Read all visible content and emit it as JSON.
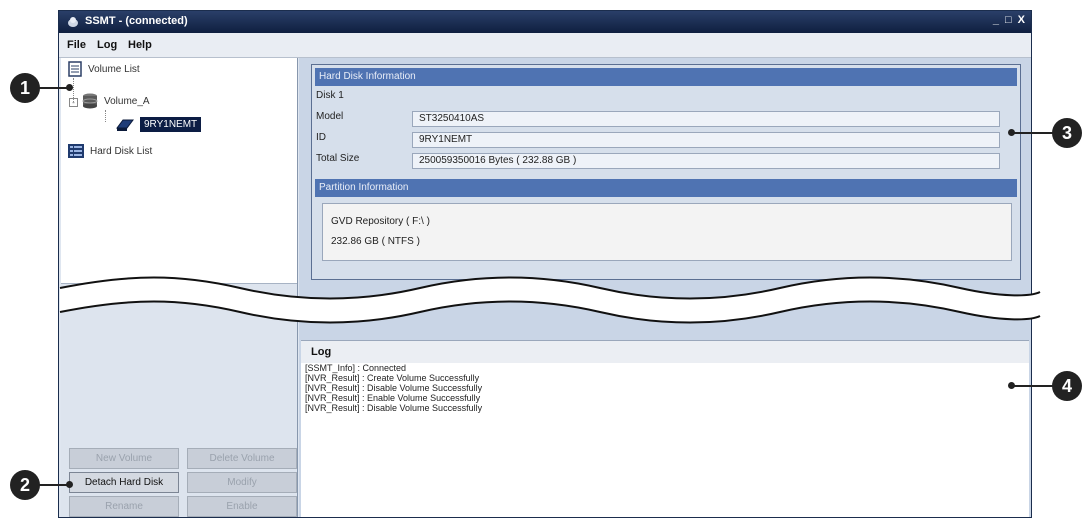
{
  "window": {
    "title": "SSMT - (connected)",
    "controls": {
      "minimize": "_",
      "maximize": "□",
      "close": "X"
    }
  },
  "menu": [
    "File",
    "Log",
    "Help"
  ],
  "tree": {
    "volume_list": "Volume List",
    "volume": "Volume_A",
    "disk": "9RY1NEMT",
    "hard_disk_list": "Hard Disk List",
    "expander": "-"
  },
  "buttons": {
    "new_volume": "New Volume",
    "delete_volume": "Delete Volume",
    "detach_hard_disk": "Detach Hard Disk",
    "modify": "Modify",
    "rename": "Rename",
    "enable": "Enable"
  },
  "hard_disk_info": {
    "header": "Hard Disk Information",
    "disk": "Disk 1",
    "model_label": "Model",
    "model": "ST3250410AS",
    "id_label": "ID",
    "id": "9RY1NEMT",
    "size_label": "Total Size",
    "size": "250059350016 Bytes ( 232.88 GB )"
  },
  "partition_info": {
    "header": "Partition Information",
    "line1": "GVD Repository ( F:\\ )",
    "line2": "232.86 GB ( NTFS )"
  },
  "log": {
    "title": "Log",
    "lines": [
      "[SSMT_Info] : Connected",
      "[NVR_Result] : Create Volume Successfully",
      "[NVR_Result] : Disable Volume Successfully",
      "[NVR_Result] : Enable Volume Successfully",
      "[NVR_Result] : Disable Volume Successfully"
    ]
  },
  "callouts": [
    "1",
    "2",
    "3",
    "4"
  ],
  "colors": {
    "titlebar": "#1b2d4d",
    "section_header": "#4f73b2",
    "selection": "#0c1d44",
    "callout": "#222222"
  }
}
